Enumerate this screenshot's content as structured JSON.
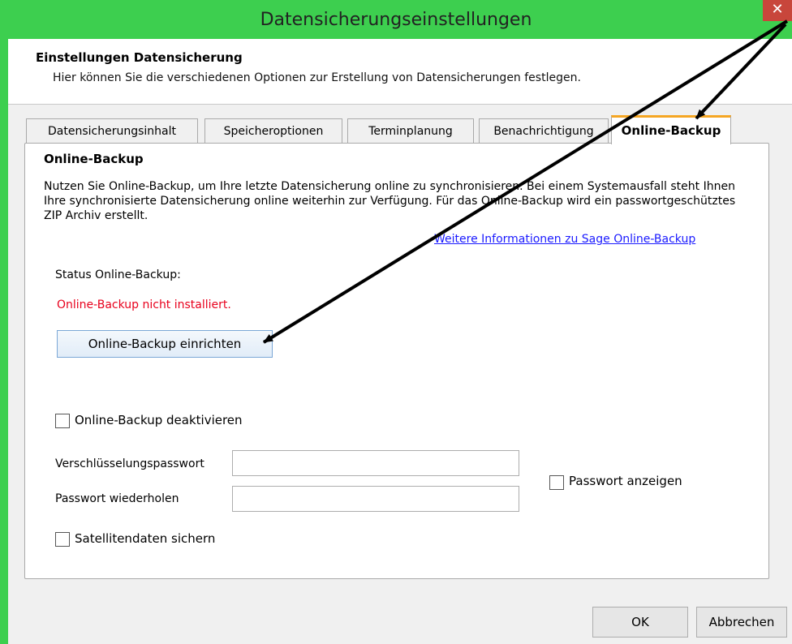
{
  "window": {
    "title": "Datensicherungseinstellungen",
    "close_glyph": "✕",
    "titlebar_color": "#3dcf4f"
  },
  "header": {
    "title": "Einstellungen Datensicherung",
    "subtitle": "Hier können Sie die verschiedenen Optionen zur Erstellung von Datensicherungen festlegen."
  },
  "tabs": [
    {
      "label": "Datensicherungsinhalt",
      "active": false
    },
    {
      "label": "Speicheroptionen",
      "active": false
    },
    {
      "label": "Terminplanung",
      "active": false
    },
    {
      "label": "Benachrichtigung",
      "active": false
    },
    {
      "label": "Online-Backup",
      "active": true
    }
  ],
  "panel": {
    "title": "Online-Backup",
    "description": "Nutzen Sie Online-Backup, um Ihre letzte Datensicherung online zu synchronisieren. Bei einem Systemausfall steht Ihnen Ihre synchronisierte Datensicherung online weiterhin zur Verfügung. Für das Online-Backup wird ein passwortgeschütztes ZIP Archiv erstellt.",
    "info_link": "Weitere Informationen zu Sage Online-Backup",
    "status_label": "Status Online-Backup:",
    "status_value": "Online-Backup nicht installiert.",
    "status_color": "#e8001c",
    "setup_button": "Online-Backup einrichten",
    "deactivate_label": "Online-Backup deaktivieren",
    "deactivate_checked": false,
    "password_label": "Verschlüsselungspasswort",
    "password_value": "",
    "repeat_label": "Passwort wiederholen",
    "repeat_value": "",
    "show_password_label": "Passwort anzeigen",
    "show_password_checked": false,
    "satellite_label": "Satellitendaten sichern",
    "satellite_checked": false
  },
  "footer": {
    "ok": "OK",
    "cancel": "Abbrechen"
  },
  "annotation": {
    "arrow_color": "#000000"
  }
}
